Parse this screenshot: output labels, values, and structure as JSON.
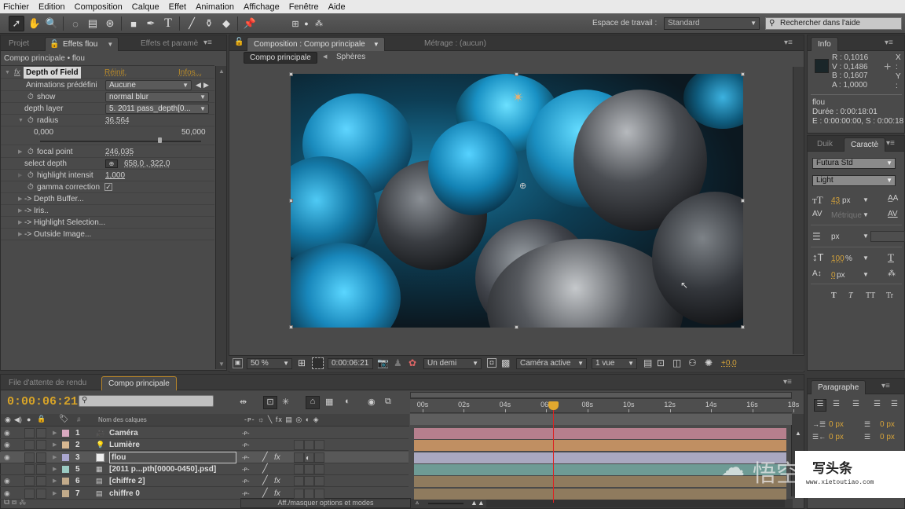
{
  "menu": [
    "Fichier",
    "Edition",
    "Composition",
    "Calque",
    "Effet",
    "Animation",
    "Affichage",
    "Fenêtre",
    "Aide"
  ],
  "toolbar": {
    "tools": [
      "selection-tool",
      "hand-tool",
      "zoom-tool",
      "rotate-tool",
      "camera-tool",
      "pan-behind-tool",
      "rectangle-tool",
      "pen-tool",
      "type-tool",
      "brush-tool",
      "clone-stamp-tool",
      "eraser-tool",
      "puppet-pin-tool",
      "local-axis",
      "world-axis",
      "view-axis"
    ],
    "workspace_label": "Espace de travail :",
    "workspace_value": "Standard",
    "help_search_placeholder": "Rechercher dans l'aide"
  },
  "effects_panel": {
    "tabs": [
      "Projet",
      "Effets flou",
      "Effets et paramè"
    ],
    "active_tab": "Effets flou",
    "breadcrumb": "Compo principale • flou",
    "effect_name": "Depth of Field",
    "reset_link": "Réinit.",
    "info_link": "Infos...",
    "properties": {
      "presets_label": "Animations prédéfini",
      "presets_value": "Aucune",
      "show_label": "show",
      "show_value": "normal blur",
      "depth_layer_label": "depth layer",
      "depth_layer_value": "5. 2011 pass_depth[0...",
      "radius_label": "radius",
      "radius_value": "36,564",
      "radius_min": "0,000",
      "radius_max": "50,000",
      "radius_fraction": 0.73,
      "focal_label": "focal point",
      "focal_value": "246,035",
      "select_depth_label": "select depth",
      "select_depth_value": "658,0 , 322,0",
      "highlight_label": "highlight intensit",
      "highlight_value": "1,000",
      "gamma_label": "gamma correction",
      "gamma_checked": true
    },
    "groups": [
      "-> Depth Buffer...",
      "-> Iris..",
      "-> Highlight Selection...",
      "-> Outside Image..."
    ]
  },
  "composition_panel": {
    "tab": "Composition : Compo principale",
    "footage_tab": "Métrage : (aucun)",
    "crumbs": [
      "Compo principale",
      "Sphères"
    ],
    "zoom": "50 %",
    "timecode": "0:00:06:21",
    "resolution": "Un demi",
    "camera": "Caméra active",
    "views": "1 vue",
    "exposure": "+0,0"
  },
  "info_panel": {
    "tab": "Info",
    "r": "R : 0,1016",
    "v": "V : 0,1486",
    "b": "B : 0,1607",
    "a": "A : 1,0000",
    "x": "X :",
    "y": "Y :",
    "swatch": "#1a2629",
    "layer": "flou",
    "duration": "Durée : 0:00:18:01",
    "in_out": "E : 0:00:00:00, S : 0:00:18"
  },
  "character_panel": {
    "tabs": [
      "Duik",
      "Caractè"
    ],
    "font": "Futura Std",
    "style": "Light",
    "size": "43",
    "size_unit": "px",
    "kerning": "Métrique",
    "leading_unit": "px",
    "vscale": "100",
    "vscale_unit": "%",
    "baseline": "0",
    "baseline_unit": "px",
    "style_buttons": [
      "T",
      "T",
      "TT",
      "Tr"
    ]
  },
  "paragraph_panel": {
    "tab": "Paragraphe",
    "indent_values": [
      "0 px",
      "0 px",
      "0 px",
      "0 px"
    ]
  },
  "timeline": {
    "tabs": [
      "File d'attente de rendu",
      "Compo principale"
    ],
    "timecode": "0:00:06:21",
    "column_header": "Nom des calques",
    "toggle_label": "Aff./masquer options et modes",
    "ruler": [
      "00s",
      "02s",
      "04s",
      "06s",
      "08s",
      "10s",
      "12s",
      "14s",
      "16s",
      "18s"
    ],
    "playhead_seconds": 6.7,
    "duration_seconds": 18,
    "layers": [
      {
        "num": "1",
        "name": "Caméra",
        "type": "camera",
        "color": "#d9a9c0",
        "bar": "#b67f8d",
        "visible": true,
        "selected": false
      },
      {
        "num": "2",
        "name": "Lumière",
        "type": "light",
        "color": "#d9b891",
        "bar": "#c08f62",
        "visible": true,
        "selected": false
      },
      {
        "num": "3",
        "name": "flou",
        "type": "solid",
        "color": "#aaa6cf",
        "bar": "#a9a8c0",
        "visible": true,
        "selected": true
      },
      {
        "num": "5",
        "name": "[2011 p...pth[0000-0450].psd]",
        "type": "footage",
        "color": "#9bcac2",
        "bar": "#6e9b95",
        "visible": false,
        "selected": false
      },
      {
        "num": "6",
        "name": "[chiffre 2]",
        "type": "comp",
        "color": "#c1aa8a",
        "bar": "#8f7b5e",
        "visible": true,
        "selected": false
      },
      {
        "num": "7",
        "name": "chiffre 0",
        "type": "comp",
        "color": "#c1aa8a",
        "bar": "#8f7b5e",
        "visible": true,
        "selected": false
      }
    ]
  },
  "watermark": {
    "brand": "悟空问答",
    "title": "写头条",
    "url": "www.xietoutiao.com"
  }
}
